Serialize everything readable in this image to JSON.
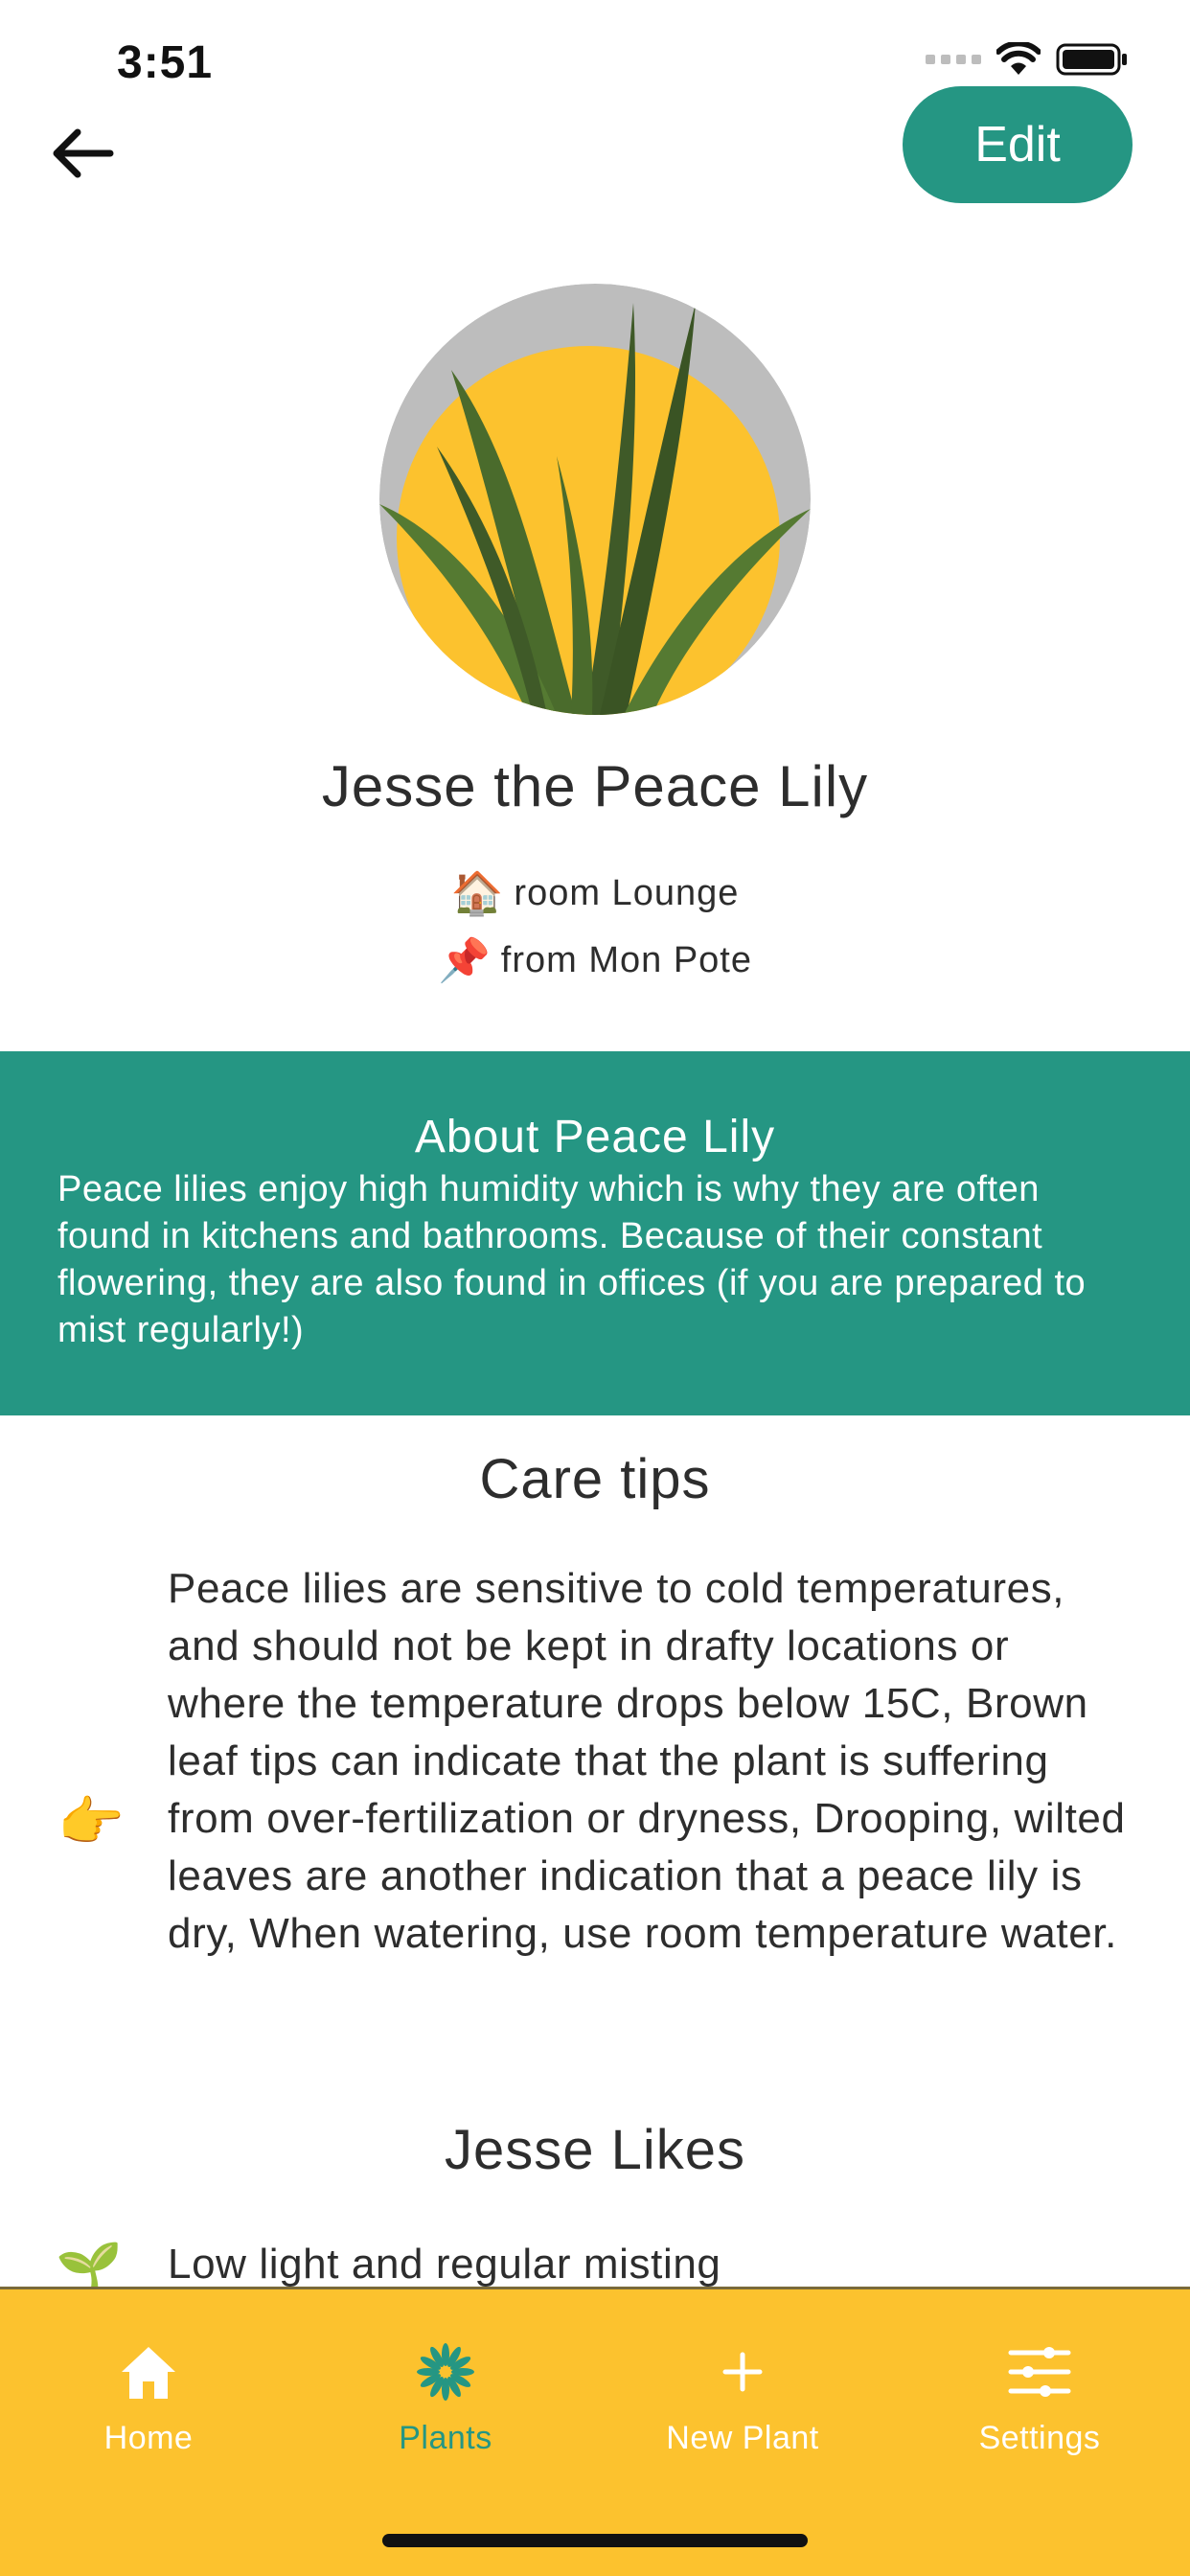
{
  "status_bar": {
    "time": "3:51"
  },
  "header": {
    "back_icon": "arrow-left-icon",
    "edit_label": "Edit"
  },
  "plant": {
    "name": "Jesse the Peace Lily",
    "room_emoji": "🏠",
    "room_text": "room Lounge",
    "from_emoji": "📌",
    "from_text": "from Mon Pote"
  },
  "about": {
    "title": "About Peace Lily",
    "text": "Peace lilies enjoy high humidity which is why they are often found in kitchens and bathrooms. Because of their constant flowering, they are also found in offices (if you are prepared to mist regularly!)"
  },
  "care_tips": {
    "title": "Care tips",
    "icon": "👉",
    "text": "Peace lilies are sensitive to cold temperatures, and should not be kept in drafty locations or where the temperature drops below 15C, Brown leaf tips can indicate that the plant is suffering from over-fertilization or dryness, Drooping, wilted leaves are another indication that a peace lily is dry, When watering, use room temperature water."
  },
  "likes": {
    "title": "Jesse Likes",
    "icon": "🌱",
    "text": "Low light and regular misting"
  },
  "tabs": [
    {
      "label": "Home",
      "icon": "home-icon",
      "active": false
    },
    {
      "label": "Plants",
      "icon": "flower-icon",
      "active": true
    },
    {
      "label": "New Plant",
      "icon": "plus-icon",
      "active": false
    },
    {
      "label": "Settings",
      "icon": "sliders-icon",
      "active": false
    }
  ],
  "colors": {
    "accent": "#259683",
    "tab_bar": "#fcc22e",
    "avatar_bg": "#bdbdbd",
    "avatar_sun": "#fcc22e",
    "leaf_dark": "#3f5a28",
    "leaf_light": "#557a32"
  }
}
